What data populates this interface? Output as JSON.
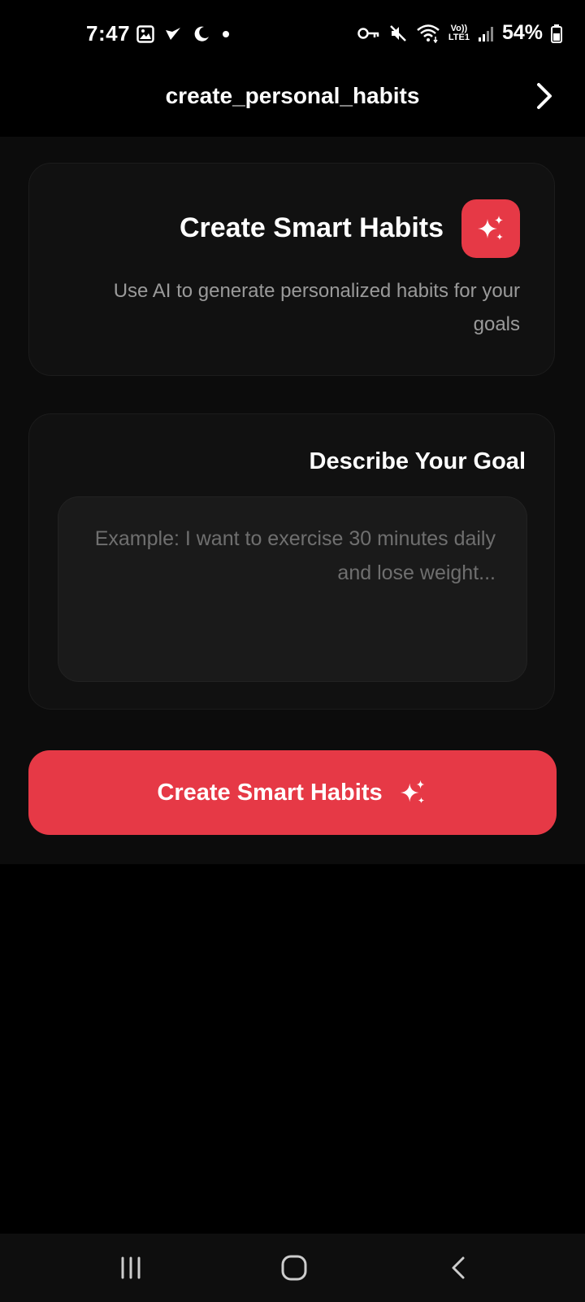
{
  "status_bar": {
    "time": "7:47",
    "battery_percent": "54%",
    "left_icons": [
      "gallery-icon",
      "check-icon",
      "moon-icon",
      "dot-icon"
    ],
    "right_icons": [
      "key-icon",
      "mute-icon",
      "wifi-icon",
      "volte-icon",
      "signal-icon",
      "battery-icon"
    ],
    "volte_label_top": "Vo))",
    "volte_label_bottom": "LTE1"
  },
  "header": {
    "title": "create_personal_habits",
    "nav_icon": "chevron-right-icon"
  },
  "hero_card": {
    "title": "Create Smart Habits",
    "description": "Use AI to generate personalized habits for your goals",
    "badge_icon": "sparkles-icon"
  },
  "goal_card": {
    "label": "Describe Your Goal",
    "input_placeholder": "Example: I want to exercise 30 minutes daily and lose weight...",
    "input_value": ""
  },
  "primary_button": {
    "label": "Create Smart Habits",
    "icon": "sparkles-icon"
  },
  "system_nav": {
    "items": [
      "recents-icon",
      "home-icon",
      "back-icon"
    ]
  },
  "colors": {
    "accent": "#e63946",
    "background": "#000000",
    "card": "#111111",
    "muted_text": "#9a9a9a"
  }
}
